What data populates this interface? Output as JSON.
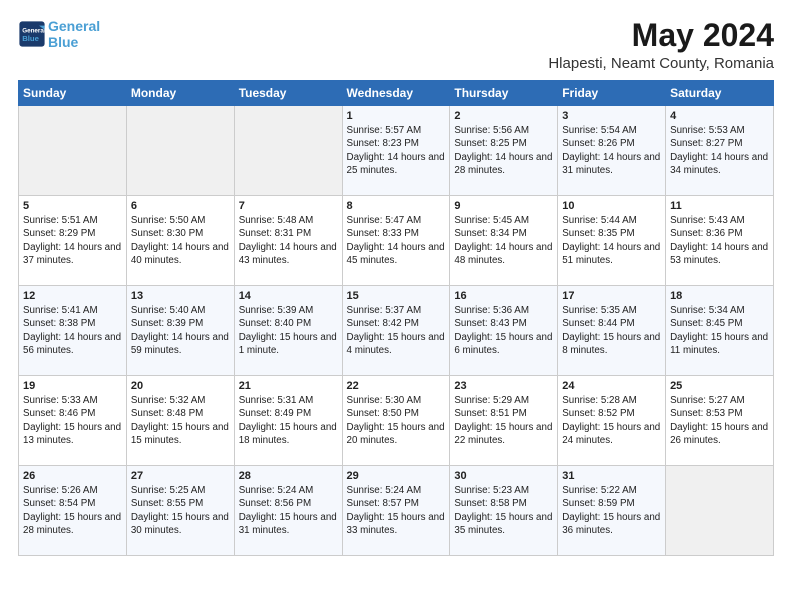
{
  "logo": {
    "text_general": "General",
    "text_blue": "Blue"
  },
  "header": {
    "month_year": "May 2024",
    "location": "Hlapesti, Neamt County, Romania"
  },
  "weekdays": [
    "Sunday",
    "Monday",
    "Tuesday",
    "Wednesday",
    "Thursday",
    "Friday",
    "Saturday"
  ],
  "weeks": [
    [
      {
        "day": "",
        "sunrise": "",
        "sunset": "",
        "daylight": ""
      },
      {
        "day": "",
        "sunrise": "",
        "sunset": "",
        "daylight": ""
      },
      {
        "day": "",
        "sunrise": "",
        "sunset": "",
        "daylight": ""
      },
      {
        "day": "1",
        "sunrise": "Sunrise: 5:57 AM",
        "sunset": "Sunset: 8:23 PM",
        "daylight": "Daylight: 14 hours and 25 minutes."
      },
      {
        "day": "2",
        "sunrise": "Sunrise: 5:56 AM",
        "sunset": "Sunset: 8:25 PM",
        "daylight": "Daylight: 14 hours and 28 minutes."
      },
      {
        "day": "3",
        "sunrise": "Sunrise: 5:54 AM",
        "sunset": "Sunset: 8:26 PM",
        "daylight": "Daylight: 14 hours and 31 minutes."
      },
      {
        "day": "4",
        "sunrise": "Sunrise: 5:53 AM",
        "sunset": "Sunset: 8:27 PM",
        "daylight": "Daylight: 14 hours and 34 minutes."
      }
    ],
    [
      {
        "day": "5",
        "sunrise": "Sunrise: 5:51 AM",
        "sunset": "Sunset: 8:29 PM",
        "daylight": "Daylight: 14 hours and 37 minutes."
      },
      {
        "day": "6",
        "sunrise": "Sunrise: 5:50 AM",
        "sunset": "Sunset: 8:30 PM",
        "daylight": "Daylight: 14 hours and 40 minutes."
      },
      {
        "day": "7",
        "sunrise": "Sunrise: 5:48 AM",
        "sunset": "Sunset: 8:31 PM",
        "daylight": "Daylight: 14 hours and 43 minutes."
      },
      {
        "day": "8",
        "sunrise": "Sunrise: 5:47 AM",
        "sunset": "Sunset: 8:33 PM",
        "daylight": "Daylight: 14 hours and 45 minutes."
      },
      {
        "day": "9",
        "sunrise": "Sunrise: 5:45 AM",
        "sunset": "Sunset: 8:34 PM",
        "daylight": "Daylight: 14 hours and 48 minutes."
      },
      {
        "day": "10",
        "sunrise": "Sunrise: 5:44 AM",
        "sunset": "Sunset: 8:35 PM",
        "daylight": "Daylight: 14 hours and 51 minutes."
      },
      {
        "day": "11",
        "sunrise": "Sunrise: 5:43 AM",
        "sunset": "Sunset: 8:36 PM",
        "daylight": "Daylight: 14 hours and 53 minutes."
      }
    ],
    [
      {
        "day": "12",
        "sunrise": "Sunrise: 5:41 AM",
        "sunset": "Sunset: 8:38 PM",
        "daylight": "Daylight: 14 hours and 56 minutes."
      },
      {
        "day": "13",
        "sunrise": "Sunrise: 5:40 AM",
        "sunset": "Sunset: 8:39 PM",
        "daylight": "Daylight: 14 hours and 59 minutes."
      },
      {
        "day": "14",
        "sunrise": "Sunrise: 5:39 AM",
        "sunset": "Sunset: 8:40 PM",
        "daylight": "Daylight: 15 hours and 1 minute."
      },
      {
        "day": "15",
        "sunrise": "Sunrise: 5:37 AM",
        "sunset": "Sunset: 8:42 PM",
        "daylight": "Daylight: 15 hours and 4 minutes."
      },
      {
        "day": "16",
        "sunrise": "Sunrise: 5:36 AM",
        "sunset": "Sunset: 8:43 PM",
        "daylight": "Daylight: 15 hours and 6 minutes."
      },
      {
        "day": "17",
        "sunrise": "Sunrise: 5:35 AM",
        "sunset": "Sunset: 8:44 PM",
        "daylight": "Daylight: 15 hours and 8 minutes."
      },
      {
        "day": "18",
        "sunrise": "Sunrise: 5:34 AM",
        "sunset": "Sunset: 8:45 PM",
        "daylight": "Daylight: 15 hours and 11 minutes."
      }
    ],
    [
      {
        "day": "19",
        "sunrise": "Sunrise: 5:33 AM",
        "sunset": "Sunset: 8:46 PM",
        "daylight": "Daylight: 15 hours and 13 minutes."
      },
      {
        "day": "20",
        "sunrise": "Sunrise: 5:32 AM",
        "sunset": "Sunset: 8:48 PM",
        "daylight": "Daylight: 15 hours and 15 minutes."
      },
      {
        "day": "21",
        "sunrise": "Sunrise: 5:31 AM",
        "sunset": "Sunset: 8:49 PM",
        "daylight": "Daylight: 15 hours and 18 minutes."
      },
      {
        "day": "22",
        "sunrise": "Sunrise: 5:30 AM",
        "sunset": "Sunset: 8:50 PM",
        "daylight": "Daylight: 15 hours and 20 minutes."
      },
      {
        "day": "23",
        "sunrise": "Sunrise: 5:29 AM",
        "sunset": "Sunset: 8:51 PM",
        "daylight": "Daylight: 15 hours and 22 minutes."
      },
      {
        "day": "24",
        "sunrise": "Sunrise: 5:28 AM",
        "sunset": "Sunset: 8:52 PM",
        "daylight": "Daylight: 15 hours and 24 minutes."
      },
      {
        "day": "25",
        "sunrise": "Sunrise: 5:27 AM",
        "sunset": "Sunset: 8:53 PM",
        "daylight": "Daylight: 15 hours and 26 minutes."
      }
    ],
    [
      {
        "day": "26",
        "sunrise": "Sunrise: 5:26 AM",
        "sunset": "Sunset: 8:54 PM",
        "daylight": "Daylight: 15 hours and 28 minutes."
      },
      {
        "day": "27",
        "sunrise": "Sunrise: 5:25 AM",
        "sunset": "Sunset: 8:55 PM",
        "daylight": "Daylight: 15 hours and 30 minutes."
      },
      {
        "day": "28",
        "sunrise": "Sunrise: 5:24 AM",
        "sunset": "Sunset: 8:56 PM",
        "daylight": "Daylight: 15 hours and 31 minutes."
      },
      {
        "day": "29",
        "sunrise": "Sunrise: 5:24 AM",
        "sunset": "Sunset: 8:57 PM",
        "daylight": "Daylight: 15 hours and 33 minutes."
      },
      {
        "day": "30",
        "sunrise": "Sunrise: 5:23 AM",
        "sunset": "Sunset: 8:58 PM",
        "daylight": "Daylight: 15 hours and 35 minutes."
      },
      {
        "day": "31",
        "sunrise": "Sunrise: 5:22 AM",
        "sunset": "Sunset: 8:59 PM",
        "daylight": "Daylight: 15 hours and 36 minutes."
      },
      {
        "day": "",
        "sunrise": "",
        "sunset": "",
        "daylight": ""
      }
    ]
  ]
}
